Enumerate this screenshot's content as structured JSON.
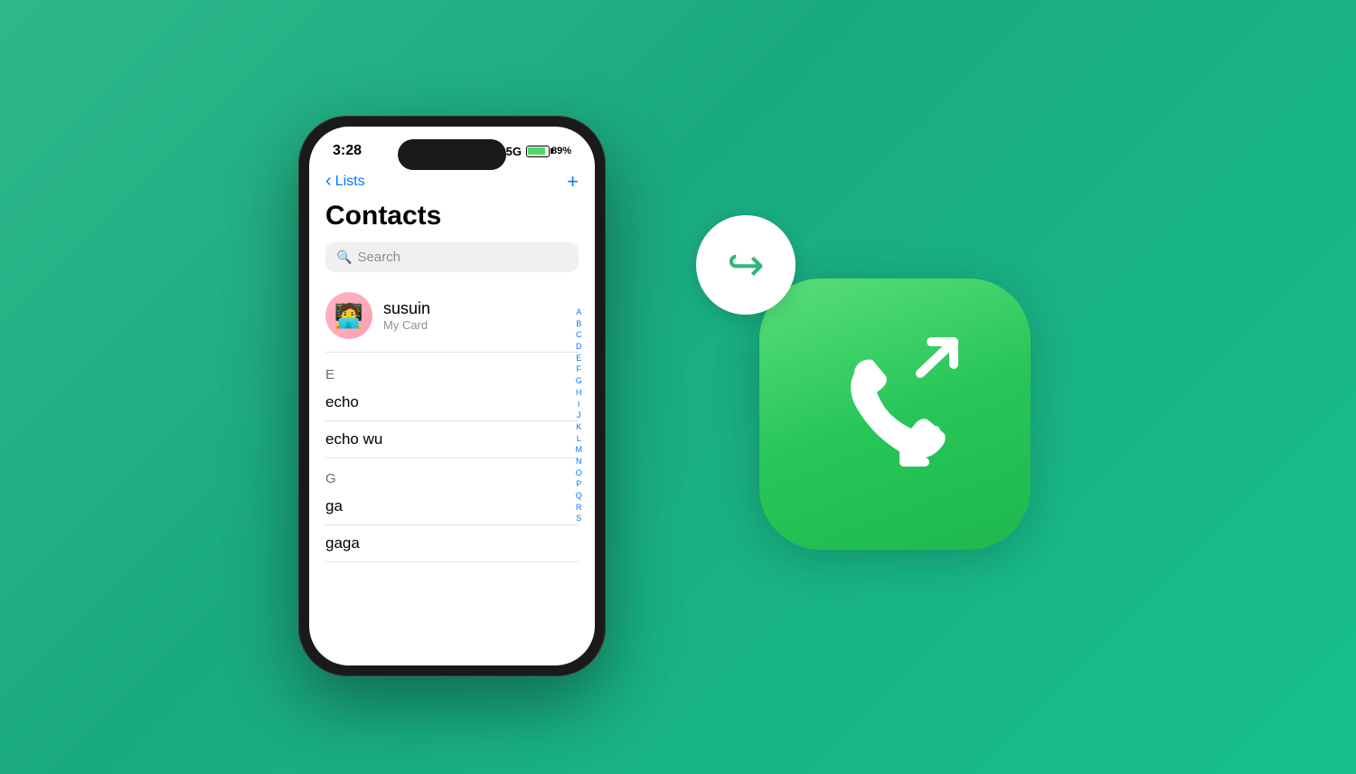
{
  "background_color": "#1fae80",
  "phone": {
    "status_bar": {
      "time": "3:28",
      "network": "5G",
      "battery_percent": "89%"
    },
    "nav": {
      "back_label": "Lists",
      "plus_label": "+"
    },
    "contacts": {
      "title": "Contacts",
      "search_placeholder": "Search",
      "my_card": {
        "name": "susuin",
        "subtitle": "My Card",
        "emoji": "🧑‍💻"
      },
      "sections": [
        {
          "letter": "E",
          "contacts": [
            "echo",
            "echo wu"
          ]
        },
        {
          "letter": "G",
          "contacts": [
            "ga",
            "gaga"
          ]
        }
      ],
      "alphabet": [
        "A",
        "B",
        "C",
        "D",
        "E",
        "F",
        "G",
        "H",
        "I",
        "J",
        "K",
        "L",
        "M",
        "N",
        "O",
        "P",
        "Q",
        "R",
        "S"
      ]
    }
  },
  "app_icon": {
    "reply_circle_icon": "reply-arrow-icon",
    "phone_icon": "phone-with-arrows-icon"
  }
}
